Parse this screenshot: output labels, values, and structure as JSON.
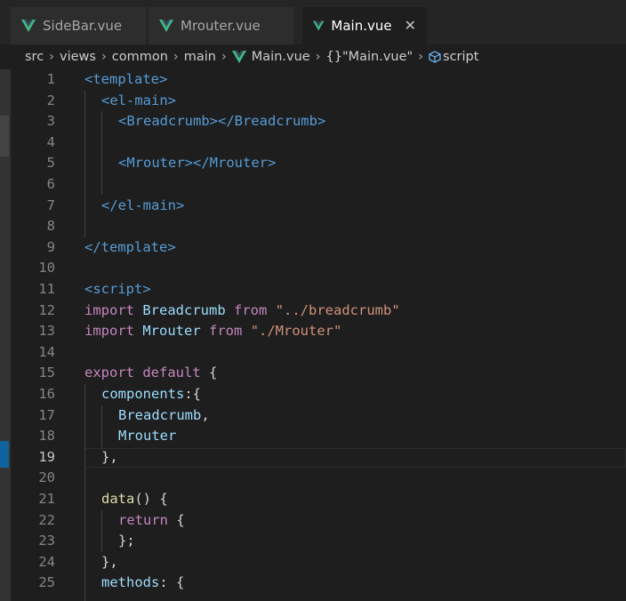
{
  "tabs": [
    {
      "label": "SideBar.vue",
      "active": false
    },
    {
      "label": "Mrouter.vue",
      "active": false
    },
    {
      "label": "Main.vue",
      "active": true
    }
  ],
  "tab_close_glyph": "✕",
  "breadcrumb": {
    "parts": [
      "src",
      "views",
      "common",
      "main"
    ],
    "file": "Main.vue",
    "symbol_braces": "{}",
    "symbol_label": "\"Main.vue\"",
    "leaf": "script",
    "separator": "›"
  },
  "colors": {
    "vue_green": "#41b883",
    "vue_dark": "#34495e",
    "tag": "#569cd6",
    "keyword": "#c586c0",
    "identifier": "#9cdcfe",
    "string": "#ce9178",
    "function": "#dcdcaa",
    "background": "#1e1e1e"
  },
  "editor": {
    "current_line": 19,
    "line_numbers": [
      "1",
      "2",
      "3",
      "4",
      "5",
      "6",
      "7",
      "8",
      "9",
      "10",
      "11",
      "12",
      "13",
      "14",
      "15",
      "16",
      "17",
      "18",
      "19",
      "20",
      "21",
      "22",
      "23",
      "24",
      "25"
    ],
    "lines": {
      "l1": {
        "t1": "<template>"
      },
      "l2": {
        "t1": "<el-main>"
      },
      "l3": {
        "t1": "<Breadcrumb>",
        "t2": "</Breadcrumb>"
      },
      "l5": {
        "t1": "<Mrouter>",
        "t2": "</Mrouter>"
      },
      "l7": {
        "t1": "</el-main>"
      },
      "l9": {
        "t1": "</template>"
      },
      "l11": {
        "t1": "<script>"
      },
      "l12": {
        "kw1": "import",
        "id": "Breadcrumb",
        "kw2": "from",
        "str": "\"../breadcrumb\""
      },
      "l13": {
        "kw1": "import",
        "id": "Mrouter",
        "kw2": "from",
        "str": "\"./Mrouter\""
      },
      "l15": {
        "kw1": "export",
        "kw2": "default",
        "pun": "{"
      },
      "l16": {
        "id": "components",
        "pun": ":{"
      },
      "l17": {
        "id": "Breadcrumb",
        "pun": ","
      },
      "l18": {
        "id": "Mrouter"
      },
      "l19": {
        "pun": "},"
      },
      "l21": {
        "fn": "data",
        "pun": "() {"
      },
      "l22": {
        "kw": "return",
        "pun": "{"
      },
      "l23": {
        "pun": "};"
      },
      "l24": {
        "pun": "},"
      },
      "l25": {
        "id": "methods",
        "pun": ": {"
      }
    }
  }
}
